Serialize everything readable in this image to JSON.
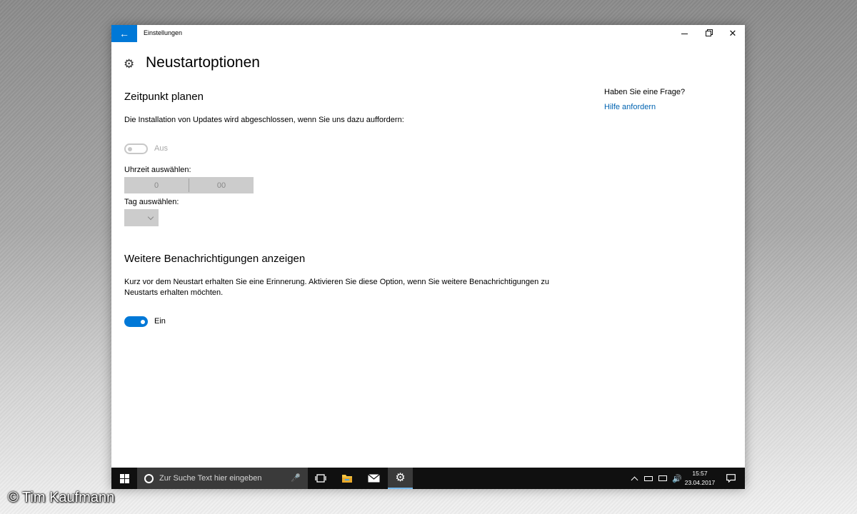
{
  "window": {
    "title": "Einstellungen",
    "page_title": "Neustartoptionen"
  },
  "schedule": {
    "heading": "Zeitpunkt planen",
    "description": "Die Installation von Updates wird abgeschlossen, wenn Sie uns dazu auffordern:",
    "toggle_label": "Aus",
    "toggle_state": "off",
    "time_label": "Uhrzeit auswählen:",
    "time_hour": "0",
    "time_minute": "00",
    "day_label": "Tag auswählen:",
    "day_value": ""
  },
  "notifications": {
    "heading": "Weitere Benachrichtigungen anzeigen",
    "description_line1": "Kurz vor dem Neustart erhalten Sie eine Erinnerung. Aktivieren Sie diese Option, wenn Sie weitere Benachrichtigungen zu",
    "description_line2": "Neustarts erhalten möchten.",
    "toggle_label": "Ein",
    "toggle_state": "on"
  },
  "sidebar": {
    "question": "Haben Sie eine Frage?",
    "help_link": "Hilfe anfordern"
  },
  "taskbar": {
    "search_placeholder": "Zur Suche Text hier eingeben",
    "time": "15:57",
    "date": "23.04.2017"
  },
  "watermark": "© Tim Kaufmann",
  "colors": {
    "accent": "#0078d7",
    "link": "#0063b1",
    "taskbar": "#101010"
  },
  "icons": [
    "back-arrow-icon",
    "minimize-icon",
    "maximize-icon",
    "close-icon",
    "gear-icon",
    "windows-logo-icon",
    "cortana-icon",
    "microphone-icon",
    "task-view-icon",
    "file-explorer-icon",
    "mail-icon",
    "settings-icon",
    "chevron-up-icon",
    "battery-icon",
    "network-icon",
    "volume-icon",
    "action-center-icon",
    "chevron-down-icon"
  ]
}
